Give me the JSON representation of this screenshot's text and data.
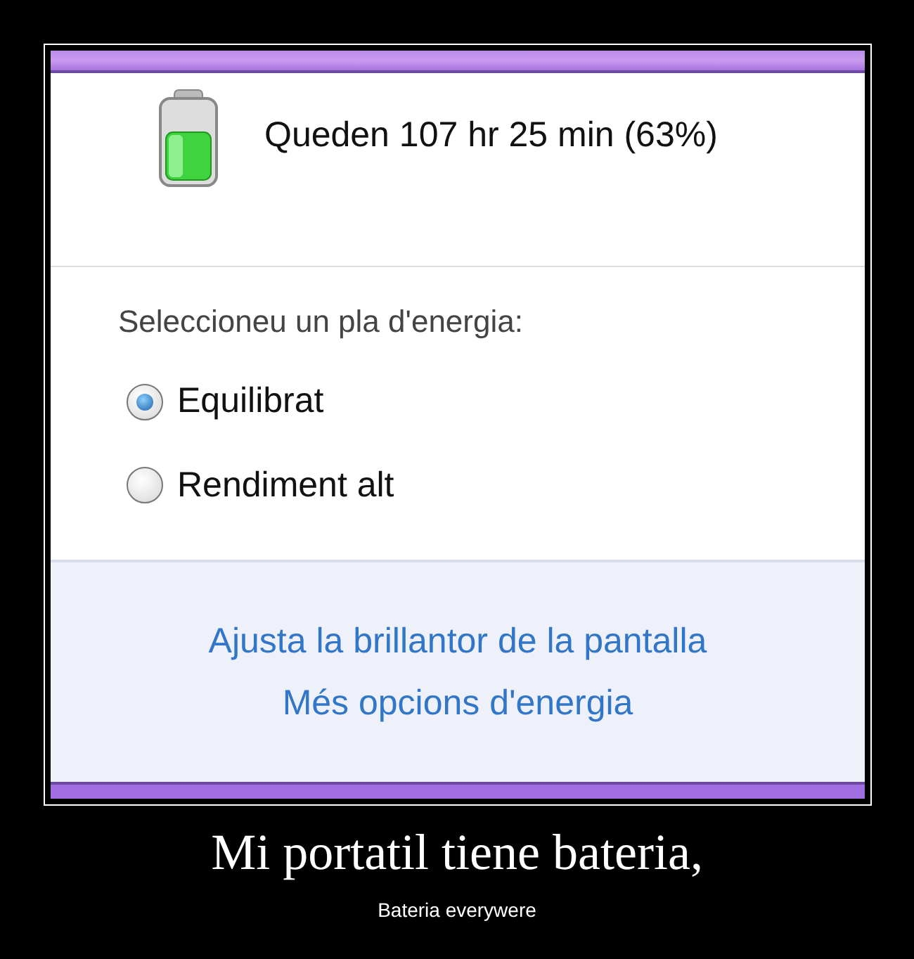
{
  "battery": {
    "status": "Queden 107 hr 25 min (63%)"
  },
  "plan": {
    "label": "Seleccioneu un pla d'energia:",
    "options": [
      {
        "label": "Equilibrat",
        "selected": true
      },
      {
        "label": "Rendiment alt",
        "selected": false
      }
    ]
  },
  "links": [
    "Ajusta la brillantor de la pantalla",
    "Més opcions d'energia"
  ],
  "caption": {
    "title": "Mi portatil tiene bateria,",
    "subtitle": "Bateria everywere"
  }
}
